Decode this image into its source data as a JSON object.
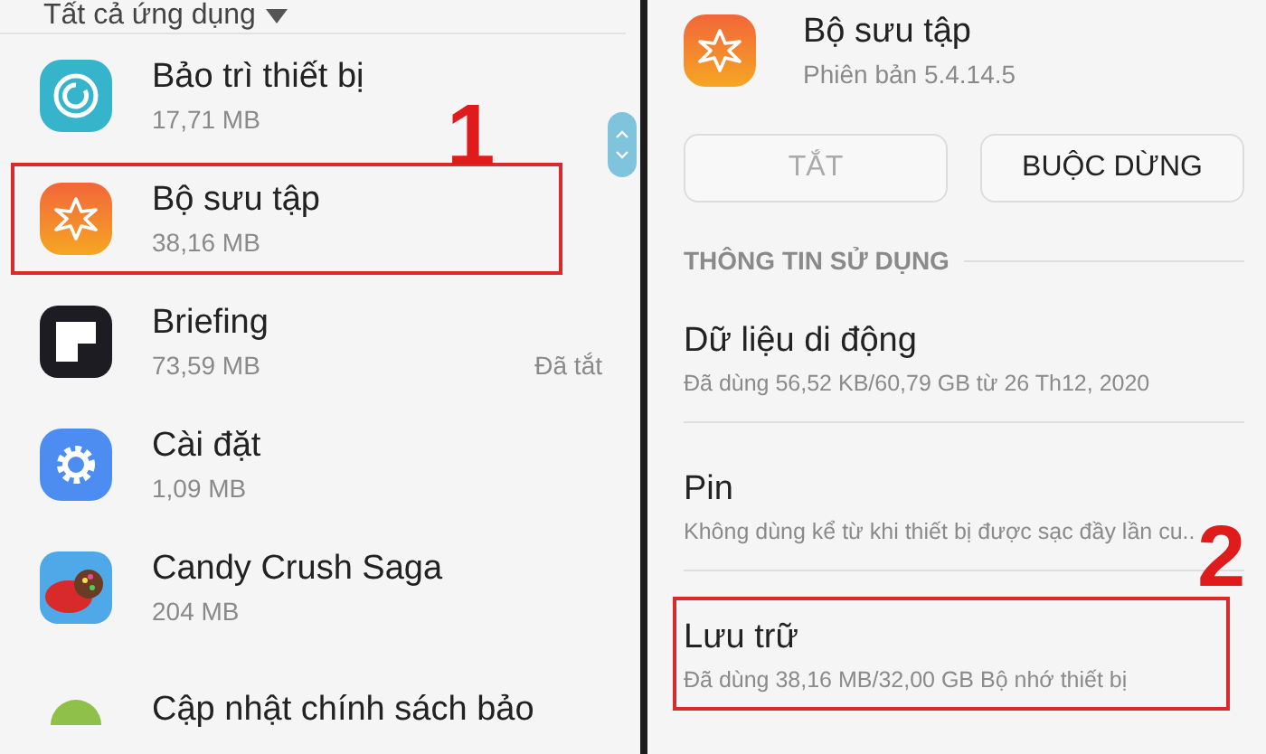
{
  "left_panel": {
    "filter": {
      "label": "Tất cả ứng dụng"
    },
    "apps": [
      {
        "kind": "maintenance",
        "name": "Bảo trì thiết bị",
        "size": "17,71 MB",
        "highlighted": false
      },
      {
        "kind": "gallery",
        "name": "Bộ sưu tập",
        "size": "38,16 MB",
        "highlighted": true
      },
      {
        "kind": "briefing",
        "name": "Briefing",
        "size": "73,59 MB",
        "status": "Đã tắt",
        "highlighted": false
      },
      {
        "kind": "settings",
        "name": "Cài đặt",
        "size": "1,09 MB",
        "highlighted": false
      },
      {
        "kind": "candy",
        "name": "Candy Crush Saga",
        "size": "204 MB",
        "highlighted": false
      },
      {
        "kind": "policy",
        "name": "Cập nhật chính sách bảo",
        "highlighted": false
      }
    ],
    "step_label": "1"
  },
  "right_panel": {
    "app": {
      "kind": "gallery",
      "name": "Bộ sưu tập",
      "version": "Phiên bản 5.4.14.5"
    },
    "buttons": [
      {
        "label": "TẮT",
        "disabled": true
      },
      {
        "label": "BUỘC DỪNG",
        "disabled": false
      }
    ],
    "section_title": "THÔNG TIN SỬ DỤNG",
    "usage": [
      {
        "title": "Dữ liệu di động",
        "detail": "Đã dùng 56,52 KB/60,79 GB từ 26 Th12, 2020",
        "highlighted": false
      },
      {
        "title": "Pin",
        "detail": "Không dùng kể từ khi thiết bị được sạc đầy lần cu..",
        "highlighted": false
      },
      {
        "title": "Lưu trữ",
        "detail": "Đã dùng 38,16 MB/32,00 GB Bộ nhớ thiết bị",
        "highlighted": true
      }
    ],
    "step_label": "2"
  }
}
